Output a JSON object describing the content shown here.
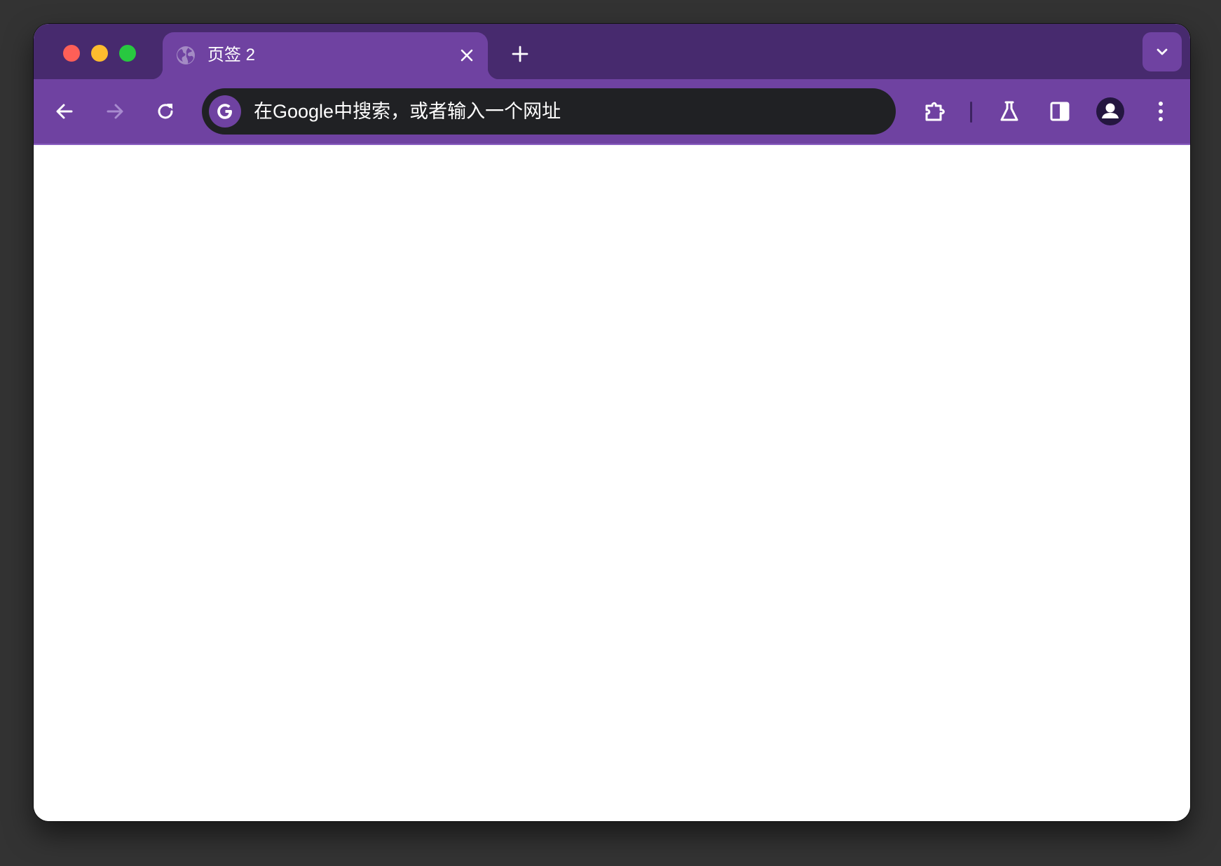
{
  "window": {
    "traffic_lights": [
      "close",
      "minimize",
      "zoom"
    ],
    "colors": {
      "tabstrip_bg": "#472a6e",
      "toolbar_bg": "#6f42a1",
      "omnibox_bg": "#202124",
      "content_bg": "#ffffff"
    }
  },
  "tabs": [
    {
      "title": "页签 2",
      "favicon": "globe-icon",
      "active": true
    }
  ],
  "tabstrip": {
    "new_tab_icon": "plus-icon",
    "tab_search_icon": "chevron-down-icon"
  },
  "toolbar": {
    "back_icon": "arrow-left-icon",
    "forward_icon": "arrow-right-icon",
    "forward_enabled": false,
    "reload_icon": "reload-icon",
    "extensions_icon": "puzzle-icon",
    "labs_icon": "flask-icon",
    "side_panel_icon": "side-panel-icon",
    "profile_icon": "avatar-icon",
    "menu_icon": "kebab-menu-icon"
  },
  "omnibox": {
    "search_engine_icon": "google-g-icon",
    "placeholder": "在Google中搜索，或者输入一个网址",
    "value": ""
  }
}
